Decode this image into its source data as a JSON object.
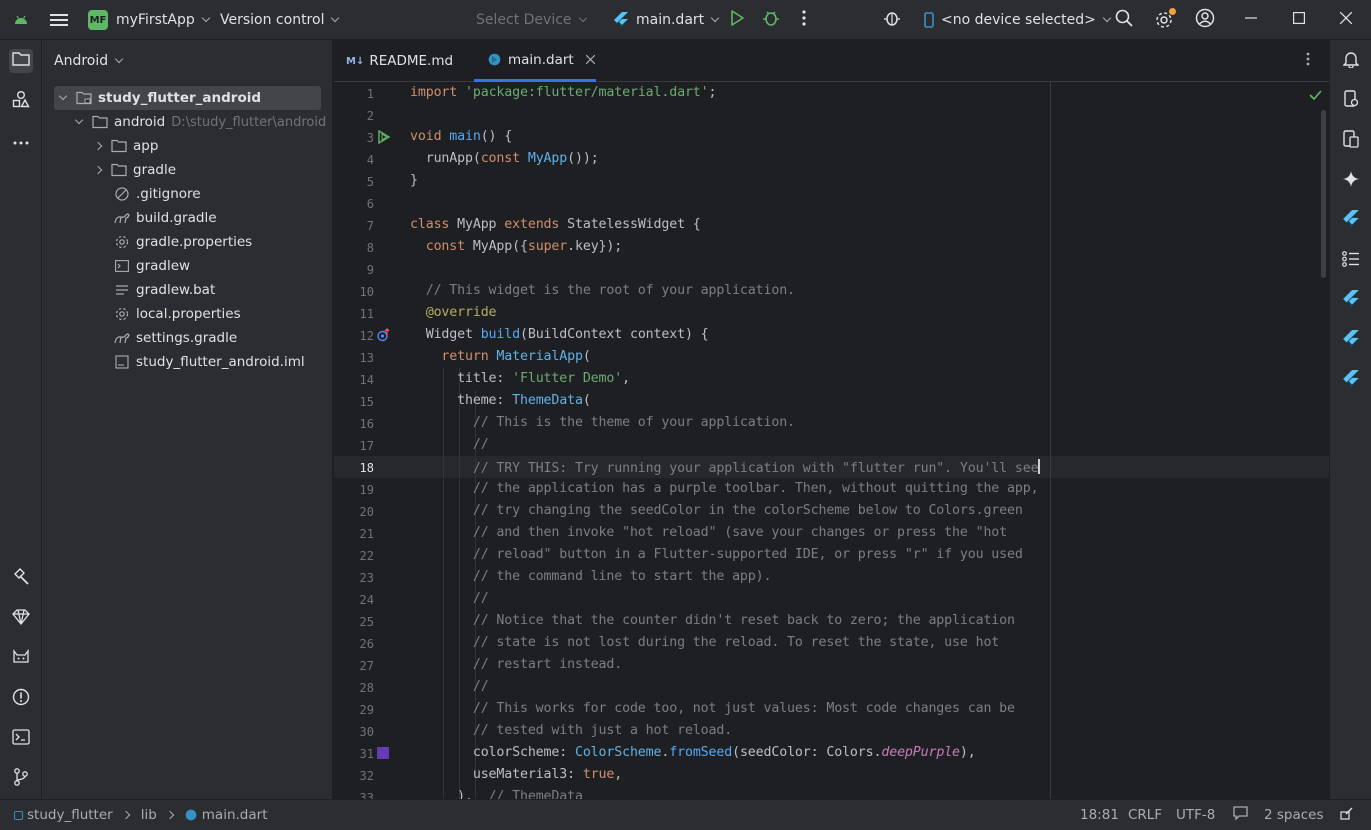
{
  "titlebar": {
    "project_badge": "MF",
    "project_name": "myFirstApp",
    "vcs": "Version control",
    "device_selector": "Select Device",
    "run_config": "main.dart",
    "device_status": "<no device selected>"
  },
  "project_panel": {
    "view": "Android",
    "root": "study_flutter_android",
    "module": "android",
    "module_path": "D:\\study_flutter\\android",
    "items": [
      {
        "label": "app",
        "type": "folder"
      },
      {
        "label": "gradle",
        "type": "folder"
      },
      {
        "label": ".gitignore",
        "type": "ignore"
      },
      {
        "label": "build.gradle",
        "type": "gradle"
      },
      {
        "label": "gradle.properties",
        "type": "settings"
      },
      {
        "label": "gradlew",
        "type": "terminal"
      },
      {
        "label": "gradlew.bat",
        "type": "bat"
      },
      {
        "label": "local.properties",
        "type": "settings"
      },
      {
        "label": "settings.gradle",
        "type": "gradle"
      },
      {
        "label": "study_flutter_android.iml",
        "type": "iml"
      }
    ]
  },
  "tabs": [
    {
      "label": "README.md",
      "badge": "M↓"
    },
    {
      "label": "main.dart",
      "active": true
    }
  ],
  "editor": {
    "line_numbers": [
      "1",
      "2",
      "3",
      "4",
      "5",
      "6",
      "7",
      "8",
      "9",
      "10",
      "11",
      "12",
      "13",
      "14",
      "15",
      "16",
      "17",
      "18",
      "19",
      "20",
      "21",
      "22",
      "23",
      "24",
      "25",
      "26",
      "27",
      "28",
      "29",
      "30",
      "31",
      "32",
      "33"
    ],
    "current_line": "18"
  },
  "statusbar": {
    "breadcrumb": [
      "study_flutter",
      "lib",
      "main.dart"
    ],
    "position": "18:81",
    "line_sep": "CRLF",
    "encoding": "UTF-8",
    "indent": "2 spaces"
  },
  "colors": {
    "accent": "#3574f0",
    "run_green": "#5fb865",
    "purple_swatch": "#673ab7"
  }
}
